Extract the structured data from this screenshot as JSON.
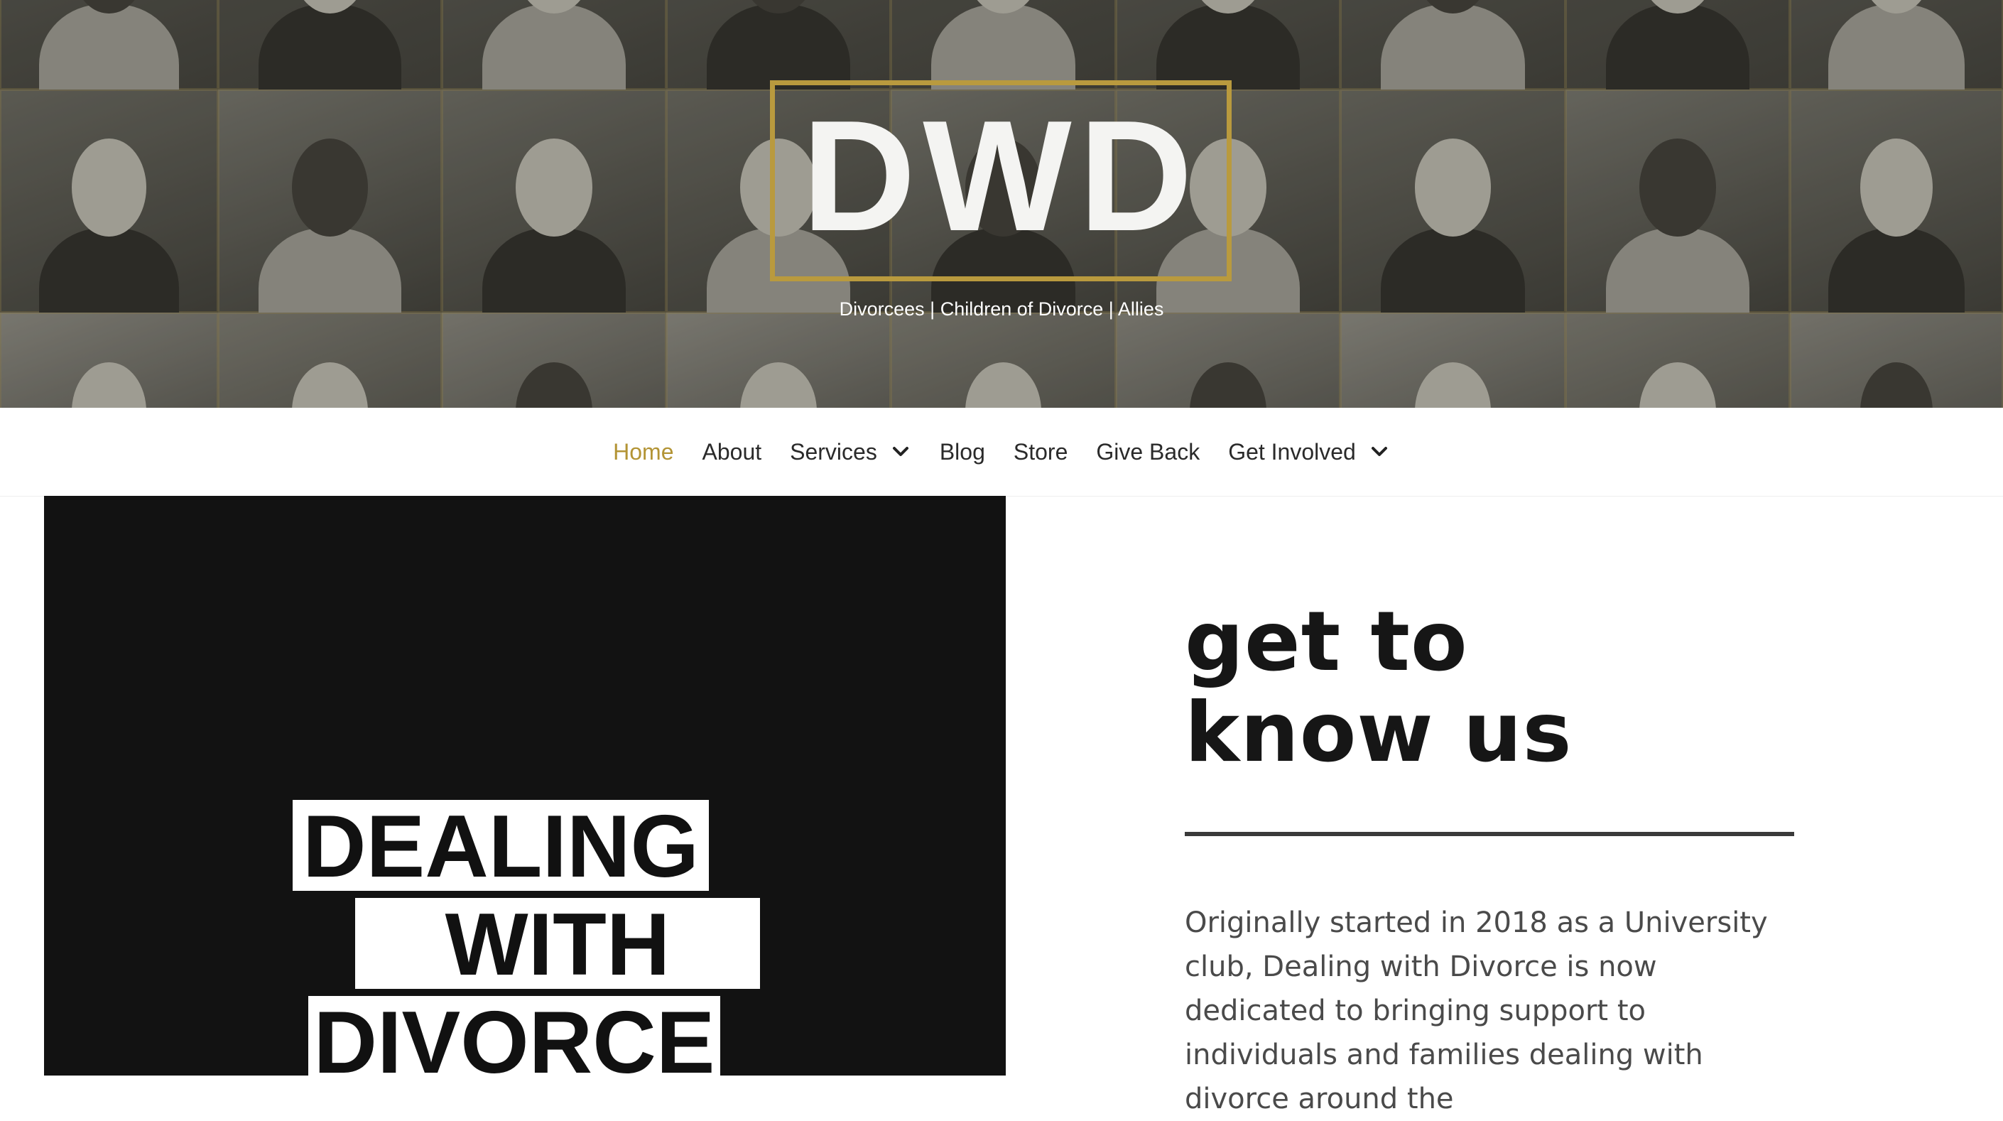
{
  "hero": {
    "logo": "DWD",
    "tagline": "Divorcees | Children of Divorce | Allies",
    "accent_color": "#b99a3e"
  },
  "nav": {
    "items": [
      {
        "label": "Home",
        "active": true
      },
      {
        "label": "About"
      },
      {
        "label": "Services",
        "dropdown": true
      },
      {
        "label": "Blog"
      },
      {
        "label": "Store"
      },
      {
        "label": "Give Back"
      },
      {
        "label": "Get Involved",
        "dropdown": true
      }
    ],
    "active_color": "#b39435",
    "icon": "chevron-down-icon"
  },
  "promo": {
    "line1": "DEALING",
    "line2": "WITH",
    "line3": "DIVORCE"
  },
  "about": {
    "heading_line1": "get to",
    "heading_line2": "know us",
    "text": "Originally started in 2018 as a University club, Dealing with Divorce is now dedicated to bringing support to individuals and families dealing with divorce around the"
  }
}
